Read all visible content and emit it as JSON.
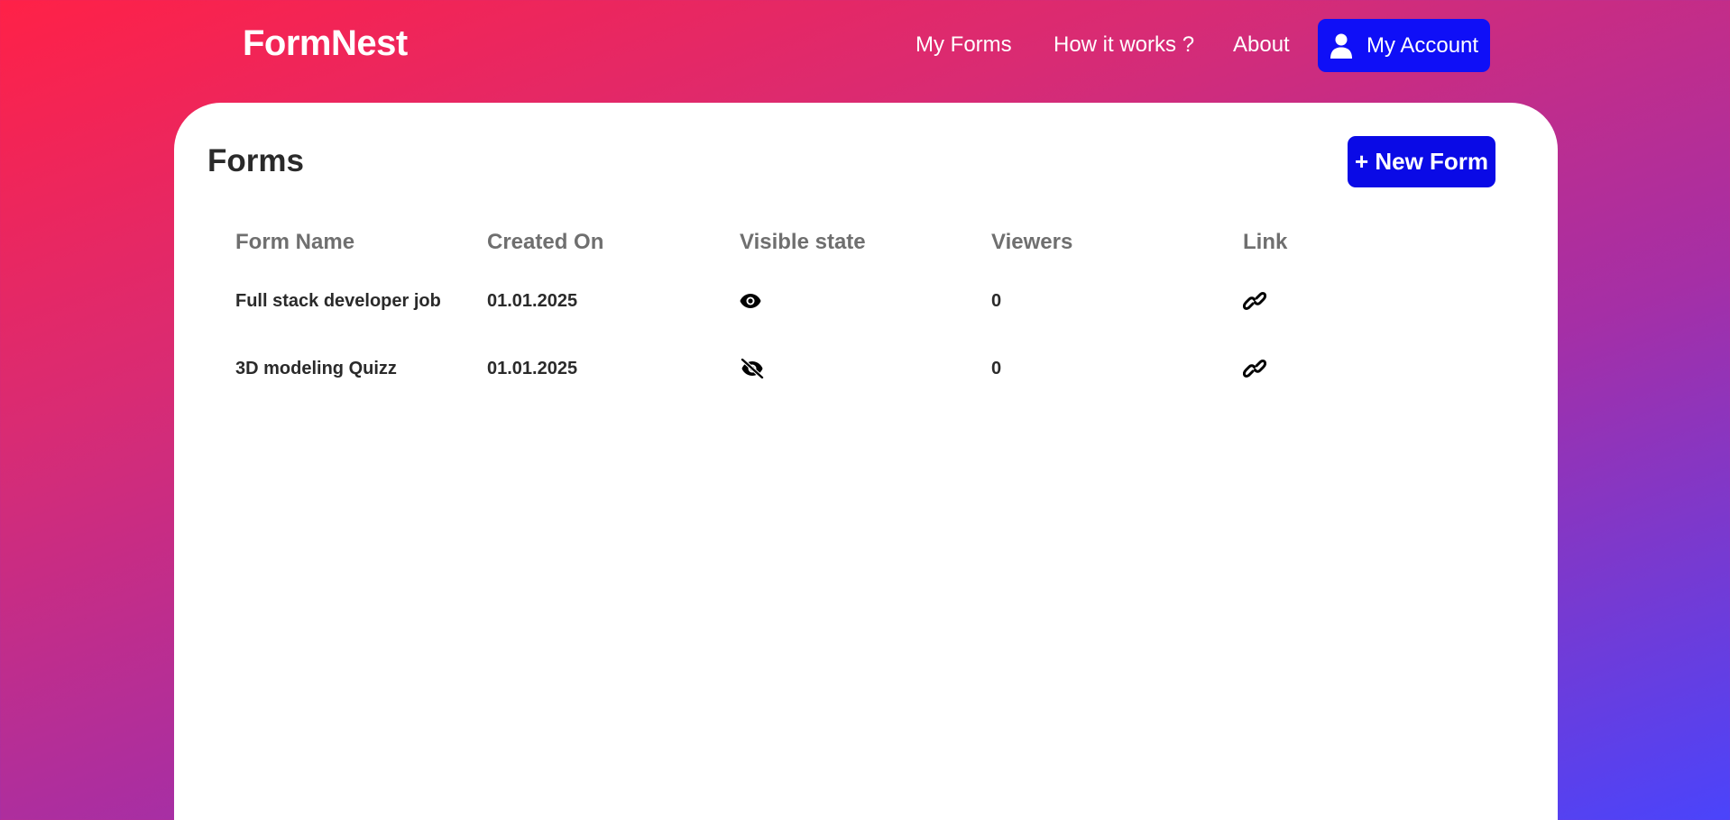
{
  "navbar": {
    "brand": "FormNest",
    "links": [
      "My Forms",
      "How it works ?",
      "About"
    ],
    "account_label": "My Account",
    "account_icon": "user-icon"
  },
  "main": {
    "title": "Forms",
    "new_form_label": "+ New Form",
    "table": {
      "headers": [
        "Form Name",
        "Created On",
        "Visible state",
        "Viewers",
        "Link"
      ],
      "rows": [
        {
          "name": "Full stack developer job",
          "created": "01.01.2025",
          "visible": "eye-icon",
          "viewers": "0",
          "link": "link-icon"
        },
        {
          "name": "3D modeling Quizz",
          "created": "01.01.2025",
          "visible": "eye-slash-icon",
          "viewers": "0",
          "link": "link-icon"
        }
      ]
    }
  },
  "colors": {
    "primary_button": "#0f0ff7",
    "gradient_start": "#ff2147",
    "gradient_end": "#4a44fb"
  }
}
